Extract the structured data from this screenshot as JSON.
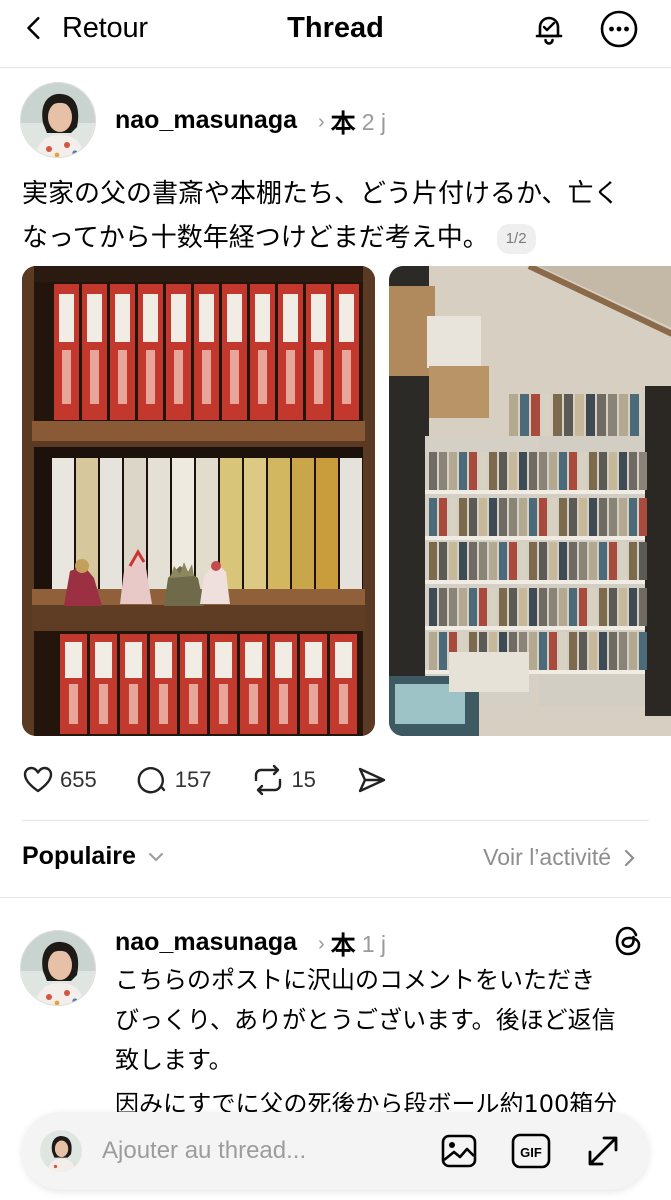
{
  "header": {
    "back_label": "Retour",
    "title": "Thread"
  },
  "post": {
    "username": "nao_masunaga",
    "topic": "本",
    "time": "2 j",
    "text_line1": "実家の父の書斎や本棚たち、どう片付けるか、亡く",
    "text_line2": "なってから十数年経つけどまだ考え中。",
    "pager": "1/2",
    "likes": "655",
    "comments": "157",
    "reposts": "15"
  },
  "section": {
    "sort_label": "Populaire",
    "activity_label": "Voir l’activité"
  },
  "reply": {
    "username": "nao_masunaga",
    "topic": "本",
    "time": "1 j",
    "lines": [
      "こちらのポストに沢山のコメントをいただき",
      "びっくり、ありがとうございます。後ほど返信",
      "致します。",
      "因みにすでに父の死後から段ボール約100箱分"
    ]
  },
  "composer": {
    "placeholder": "Ajouter au thread..."
  },
  "icons": {
    "back": "chevron-left-icon",
    "notify": "bell-icon",
    "more": "more-horizontal-icon",
    "like": "heart-icon",
    "comment": "comment-bubble-icon",
    "repost": "repost-icon",
    "share": "send-icon",
    "threads": "threads-logo-icon",
    "image": "image-icon",
    "gif": "gif-icon",
    "expand": "expand-icon"
  }
}
